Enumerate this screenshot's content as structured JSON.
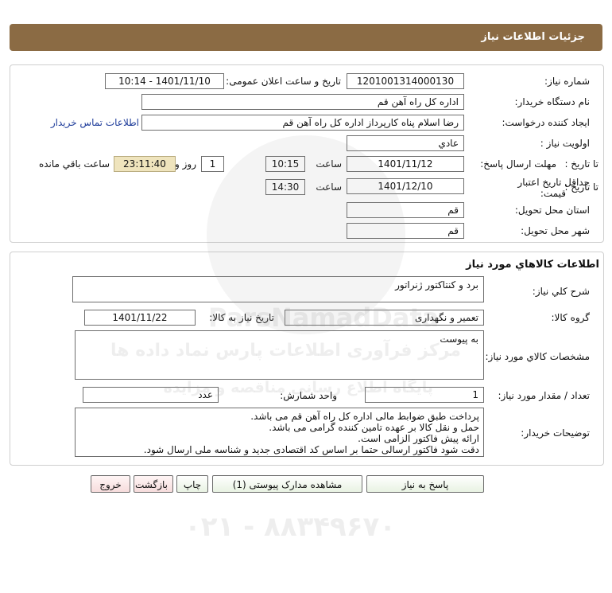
{
  "header": {
    "title": "جزئیات اطلاعات نیاز"
  },
  "need": {
    "need_number_label": "شماره نیاز:",
    "need_number": "1201001314000130",
    "announce_label": "تاریخ و ساعت اعلان عمومی:",
    "announce_value": "1401/11/10 - 10:14",
    "buyer_org_label": "نام دستگاه خریدار:",
    "buyer_org": "اداره کل  راه آهن قم",
    "requester_label": "ایجاد کننده درخواست:",
    "requester": "رضا اسلام پناه کارپرداز اداره کل  راه آهن قم",
    "contact_link": "اطلاعات تماس خریدار",
    "priority_label": "اولویت نیاز :",
    "priority": "عادي",
    "reply_deadline_label": "مهلت ارسال پاسخ:",
    "to_date_label": "تا تاریخ :",
    "reply_date": "1401/11/12",
    "time_label": "ساعت",
    "reply_time": "10:15",
    "days": "1",
    "days_label": "روز و",
    "remaining": "23:11:40",
    "remaining_label": "ساعت باقي مانده",
    "validity_label_1": "حداقل تاریخ اعتبار",
    "validity_label_2": "قیمت:",
    "validity_to_label": "تا تاریخ :",
    "validity_date": "1401/12/10",
    "validity_time_label": "ساعت",
    "validity_time": "14:30",
    "province_label": "استان محل تحویل:",
    "province": "قم",
    "city_label": "شهر محل تحویل:",
    "city": "قم"
  },
  "goods": {
    "section_title": "اطلاعات کالاهاي مورد نياز",
    "summary_label": "شرح کلي نياز:",
    "summary": "برد و کنتاکتور ژنراتور",
    "group_label": "گروه کالا:",
    "group": "تعمیر و نگهداری",
    "need_date_label": "تاریخ نیاز به کالا:",
    "need_date": "1401/11/22",
    "specs_label": "مشخصات کالاي مورد نياز:",
    "specs": "به پیوست",
    "qty_label": "تعداد / مقدار مورد نیاز:",
    "qty": "1",
    "unit_label": "واحد شمارش:",
    "unit": "عدد",
    "notes_label": "توضیحات خریدار:",
    "notes": [
      "پرداخت طبق ضوابط مالی اداره کل راه آهن قم می باشد.",
      "حمل و نقل کالا بر عهده تامین کننده گرامی می باشد.",
      "ارائه پیش فاکتور الزامی است.",
      "دقت شود فاکتور ارسالی حتما بر اساس کد اقتصادی جدید و شناسه ملی ارسال شود."
    ]
  },
  "buttons": {
    "reply": "پاسخ به نیاز",
    "attachments": "مشاهده مدارک پیوستی (1)",
    "print": "چاپ",
    "back": "بازگشت",
    "exit": "خروج"
  },
  "watermark": {
    "brand": "ParsNamadData",
    "line1": "مرکز فرآوری اطلاعات پارس نماد داده ها",
    "line2": "پایگاه اطلاع رسانی مناقصه و مزایده",
    "phone": "۰۲۱ - ۸۸۳۴۹۶۷۰"
  }
}
